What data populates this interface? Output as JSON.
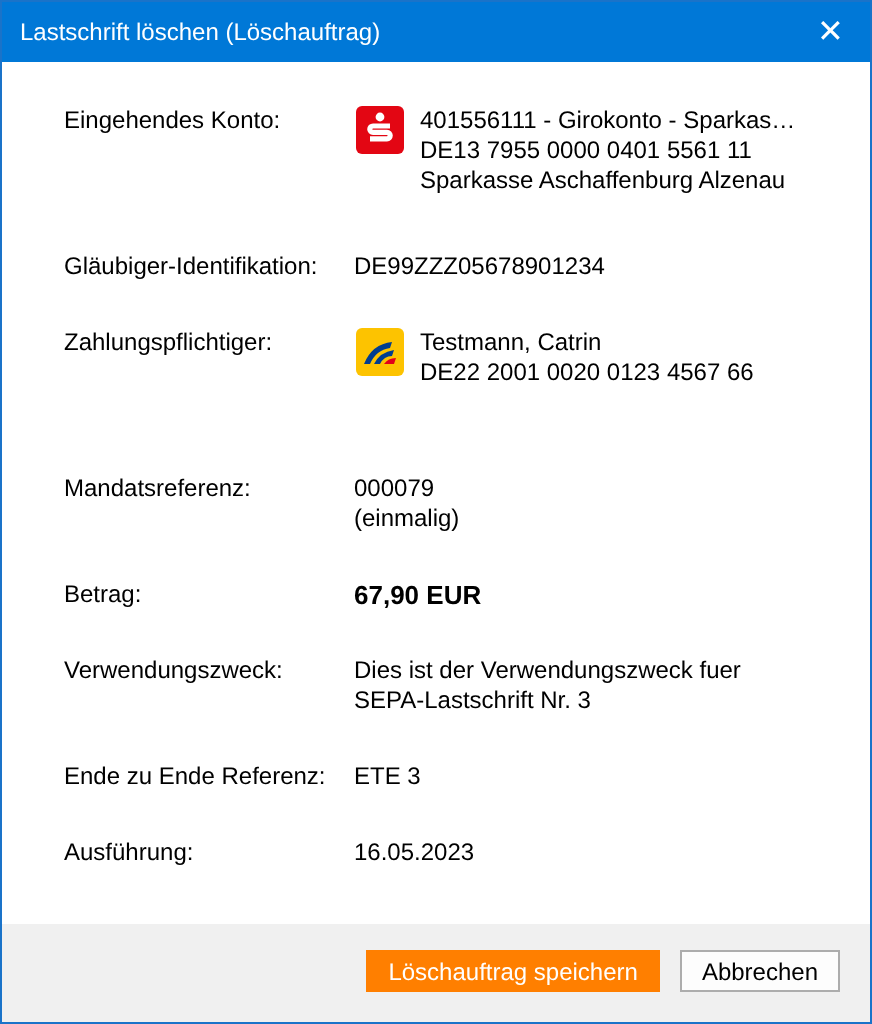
{
  "window": {
    "title": "Lastschrift löschen (Löschauftrag)",
    "close": "✕"
  },
  "fields": [
    {
      "label": "Eingehendes Konto:",
      "kind": "incoming",
      "lines": [
        "401556111 - Girokonto - Sparkas…",
        "DE13 7955 0000 0401 5561 11",
        "Sparkasse Aschaffenburg Alzenau"
      ],
      "emphasis": false
    },
    {
      "label": "Gläubiger-Identifikation:",
      "kind": "plain",
      "lines": [
        "DE99ZZZ05678901234"
      ],
      "emphasis": false
    },
    {
      "label": "Zahlungspflichtiger:",
      "kind": "payer",
      "lines": [
        "Testmann, Catrin",
        "DE22 2001 0020 0123 4567 66"
      ],
      "emphasis": false
    },
    {
      "label": "Mandatsreferenz:",
      "kind": "plain",
      "lines": [
        "000079",
        "(einmalig)"
      ],
      "emphasis": false
    },
    {
      "label": "Betrag:",
      "kind": "plain",
      "lines": [
        "67,90 EUR"
      ],
      "emphasis": true
    },
    {
      "label": "Verwendungszweck:",
      "kind": "plain",
      "lines": [
        "Dies ist der Verwendungszweck fuer",
        "SEPA-Lastschrift Nr. 3"
      ],
      "emphasis": false
    },
    {
      "label": "Ende zu Ende Referenz:",
      "kind": "plain",
      "lines": [
        "ETE 3"
      ],
      "emphasis": false
    },
    {
      "label": "Ausführung:",
      "kind": "plain",
      "lines": [
        "16.05.2023"
      ],
      "emphasis": false
    }
  ],
  "buttons": [
    {
      "label": "Löschauftrag speichern",
      "kind": "primary"
    },
    {
      "label": "Abbrechen",
      "kind": "secondary"
    }
  ]
}
